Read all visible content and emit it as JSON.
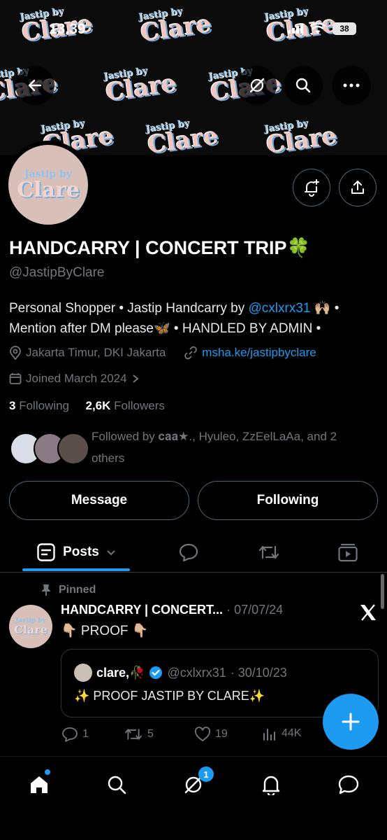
{
  "status_bar": {
    "time": "13.39",
    "battery": "38"
  },
  "banner": {
    "tile_small": "Jastip by",
    "tile_large": "Clare"
  },
  "avatar": {
    "line1": "Jastip by",
    "line2": "Clare"
  },
  "profile": {
    "name": "HANDCARRY | CONCERT TRIP🍀",
    "handle": "@JastipByClare",
    "bio_part1": "Personal Shopper • Jastip Handcarry by ",
    "bio_mention": "@cxlxrx31",
    "bio_part2": " 🙌🏼 • Mention after DM please🦋 • HANDLED BY ADMIN •",
    "location": "Jakarta Timur, DKI Jakarta",
    "website": "msha.ke/jastipbyclare",
    "joined": "Joined March 2024",
    "following_count": "3",
    "following_label": "Following",
    "followers_count": "2,6K",
    "followers_label": "Followers",
    "followed_by": "Followed by 𝐜𝐚𝐚★., Hyuleo, ZzEelLaAa, and 2 others"
  },
  "buttons": {
    "message": "Message",
    "following": "Following"
  },
  "tabs": {
    "posts": "Posts"
  },
  "pinned_post": {
    "pinned_label": "Pinned",
    "author": "HANDCARRY | CONCERT...",
    "date": "· 07/07/24",
    "text": "👇🏼 PROOF 👇🏼",
    "quote": {
      "name": "clare,🥀",
      "handle": "@cxlxrx31",
      "date": "· 30/10/23",
      "text": "✨ PROOF JASTIP BY CLARE✨"
    },
    "replies": "1",
    "reposts": "5",
    "likes": "19",
    "views": "44K"
  },
  "nav": {
    "messages_badge": "1"
  },
  "colors": {
    "accent": "#1d9bf0",
    "background": "#000000",
    "muted": "#71767b"
  }
}
